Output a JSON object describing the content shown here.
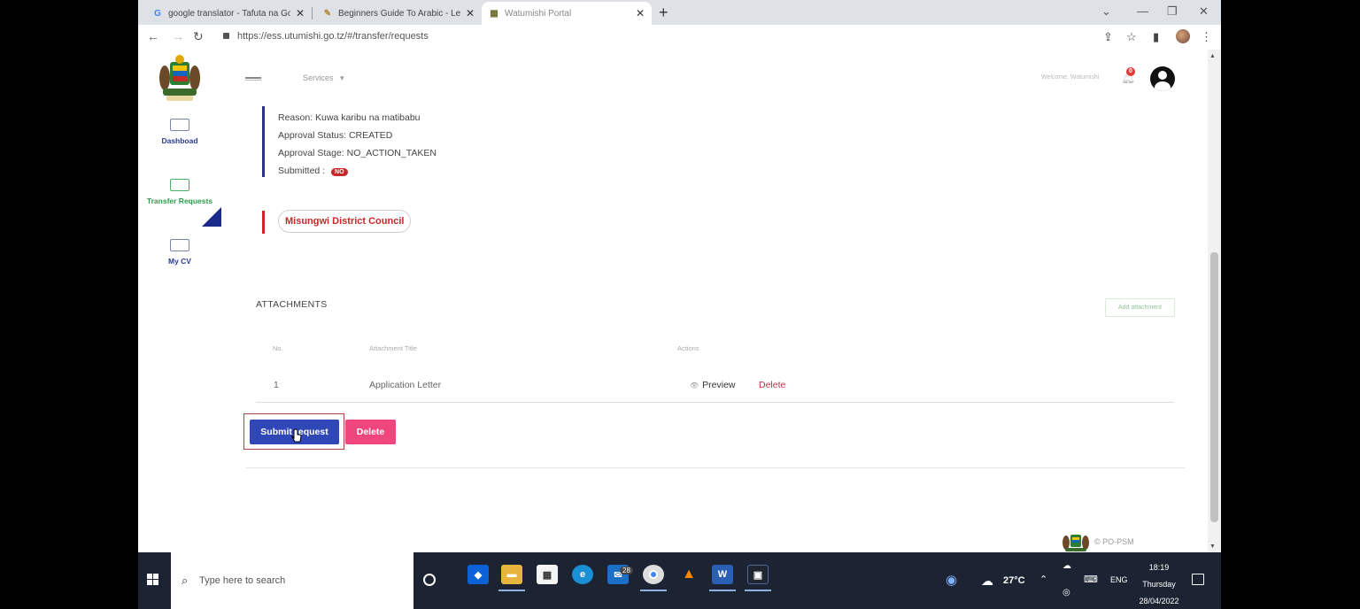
{
  "browser": {
    "tabs": [
      {
        "icon": "G",
        "title": "google translator - Tafuta na Go"
      },
      {
        "icon": "✎",
        "title": "Beginners Guide To Arabic - Lea"
      },
      {
        "icon": "▦",
        "title": "Watumishi Portal"
      }
    ],
    "url": "https://ess.utumishi.go.tz/#/transfer/requests"
  },
  "sidebar": {
    "items": [
      {
        "label": "Dashboad",
        "color": "#2b3a8f"
      },
      {
        "label": "Transfer Requests",
        "color": "#2e9c4a"
      },
      {
        "label": "My CV",
        "color": "#2b3a8f"
      }
    ]
  },
  "topnav": {
    "services_label": "Services",
    "welcome": "Welcome, Watumishi",
    "notification_count": "0"
  },
  "request": {
    "reason": "Reason: Kuwa karibu na matibabu",
    "approval_status": "Approval Status: CREATED",
    "approval_stage": "Approval Stage: NO_ACTION_TAKEN",
    "submitted_label": "Submitted :",
    "submitted_value": "NO",
    "destination": "Misungwi District Council"
  },
  "attachments": {
    "title": "ATTACHMENTS",
    "add_label": "Add attachment",
    "columns": [
      "No.",
      "Attachment Title",
      "Actions"
    ],
    "rows": [
      {
        "no": "1",
        "title": "Application Letter",
        "preview": "Preview",
        "delete": "Delete"
      }
    ]
  },
  "actions": {
    "submit_label": "Submit request",
    "delete_label": "Delete"
  },
  "footer": {
    "text": "© PO-PSM"
  },
  "taskbar": {
    "search_placeholder": "Type here to search",
    "mail_badge": "28",
    "weather": "27°C",
    "language": "ENG",
    "time": "18:19",
    "day": "Thursday",
    "date": "28/04/2022"
  },
  "colors": {
    "primary": "#3047b8",
    "danger_button": "#f0467e",
    "danger_text": "#c62828",
    "accent_green": "#2e9c4a"
  }
}
